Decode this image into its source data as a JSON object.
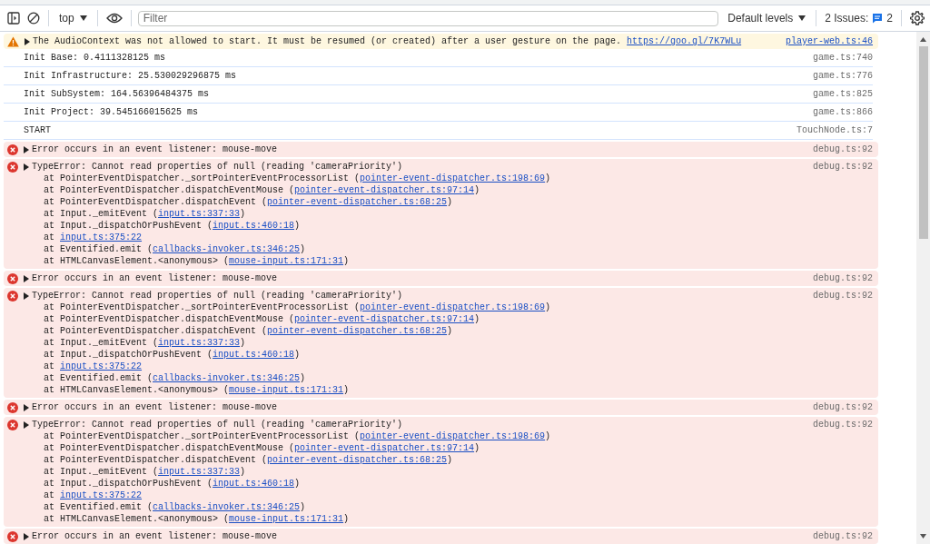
{
  "toolbar": {
    "context": "top",
    "filter": {
      "placeholder": "Filter"
    },
    "levels": "Default levels",
    "issues_label": "2 Issues:",
    "issues_count": "2"
  },
  "messages": [
    {
      "kind": "warning",
      "text": "The AudioContext was not allowed to start. It must be resumed (or created) after a user gesture on the page.",
      "link": "https://goo.gl/7K7WLu",
      "source": "player-web.ts:46",
      "expandable": true
    },
    {
      "kind": "log",
      "text": "Init Base: 0.4111328125 ms",
      "source": "game.ts:740",
      "expandable": false
    },
    {
      "kind": "log",
      "text": "Init Infrastructure: 25.530029296875 ms",
      "source": "game.ts:776",
      "expandable": false
    },
    {
      "kind": "log",
      "text": "Init SubSystem: 164.56396484375 ms",
      "source": "game.ts:825",
      "expandable": false
    },
    {
      "kind": "log",
      "text": "Init Project: 39.545166015625 ms",
      "source": "game.ts:866",
      "expandable": false
    },
    {
      "kind": "log",
      "text": "START",
      "source": "TouchNode.ts:7",
      "expandable": false
    },
    {
      "kind": "error",
      "text": "Error occurs in an event listener: mouse-move",
      "source": "debug.ts:92",
      "expandable": true
    },
    {
      "kind": "error",
      "text": "TypeError: Cannot read properties of null (reading 'cameraPriority')",
      "source": "debug.ts:92",
      "expandable": true,
      "stack": [
        {
          "before": "at PointerEventDispatcher._sortPointerEventProcessorList (",
          "link": "pointer-event-dispatcher.ts:198:69",
          "after": ")"
        },
        {
          "before": "at PointerEventDispatcher.dispatchEventMouse (",
          "link": "pointer-event-dispatcher.ts:97:14",
          "after": ")"
        },
        {
          "before": "at PointerEventDispatcher.dispatchEvent (",
          "link": "pointer-event-dispatcher.ts:68:25",
          "after": ")"
        },
        {
          "before": "at Input._emitEvent (",
          "link": "input.ts:337:33",
          "after": ")"
        },
        {
          "before": "at Input._dispatchOrPushEvent (",
          "link": "input.ts:460:18",
          "after": ")"
        },
        {
          "before": "at ",
          "link": "input.ts:375:22"
        },
        {
          "before": "at Eventified.emit (",
          "link": "callbacks-invoker.ts:346:25",
          "after": ")"
        },
        {
          "before": "at HTMLCanvasElement.<anonymous> (",
          "link": "mouse-input.ts:171:31",
          "after": ")"
        }
      ]
    },
    {
      "kind": "error",
      "text": "Error occurs in an event listener: mouse-move",
      "source": "debug.ts:92",
      "expandable": true
    },
    {
      "kind": "error",
      "text": "TypeError: Cannot read properties of null (reading 'cameraPriority')",
      "source": "debug.ts:92",
      "expandable": true,
      "stack": [
        {
          "before": "at PointerEventDispatcher._sortPointerEventProcessorList (",
          "link": "pointer-event-dispatcher.ts:198:69",
          "after": ")"
        },
        {
          "before": "at PointerEventDispatcher.dispatchEventMouse (",
          "link": "pointer-event-dispatcher.ts:97:14",
          "after": ")"
        },
        {
          "before": "at PointerEventDispatcher.dispatchEvent (",
          "link": "pointer-event-dispatcher.ts:68:25",
          "after": ")"
        },
        {
          "before": "at Input._emitEvent (",
          "link": "input.ts:337:33",
          "after": ")"
        },
        {
          "before": "at Input._dispatchOrPushEvent (",
          "link": "input.ts:460:18",
          "after": ")"
        },
        {
          "before": "at ",
          "link": "input.ts:375:22"
        },
        {
          "before": "at Eventified.emit (",
          "link": "callbacks-invoker.ts:346:25",
          "after": ")"
        },
        {
          "before": "at HTMLCanvasElement.<anonymous> (",
          "link": "mouse-input.ts:171:31",
          "after": ")"
        }
      ]
    },
    {
      "kind": "error",
      "text": "Error occurs in an event listener: mouse-move",
      "source": "debug.ts:92",
      "expandable": true
    },
    {
      "kind": "error",
      "text": "TypeError: Cannot read properties of null (reading 'cameraPriority')",
      "source": "debug.ts:92",
      "expandable": true,
      "stack": [
        {
          "before": "at PointerEventDispatcher._sortPointerEventProcessorList (",
          "link": "pointer-event-dispatcher.ts:198:69",
          "after": ")"
        },
        {
          "before": "at PointerEventDispatcher.dispatchEventMouse (",
          "link": "pointer-event-dispatcher.ts:97:14",
          "after": ")"
        },
        {
          "before": "at PointerEventDispatcher.dispatchEvent (",
          "link": "pointer-event-dispatcher.ts:68:25",
          "after": ")"
        },
        {
          "before": "at Input._emitEvent (",
          "link": "input.ts:337:33",
          "after": ")"
        },
        {
          "before": "at Input._dispatchOrPushEvent (",
          "link": "input.ts:460:18",
          "after": ")"
        },
        {
          "before": "at ",
          "link": "input.ts:375:22"
        },
        {
          "before": "at Eventified.emit (",
          "link": "callbacks-invoker.ts:346:25",
          "after": ")"
        },
        {
          "before": "at HTMLCanvasElement.<anonymous> (",
          "link": "mouse-input.ts:171:31",
          "after": ")"
        }
      ]
    },
    {
      "kind": "error",
      "text": "Error occurs in an event listener: mouse-move",
      "source": "debug.ts:92",
      "expandable": true
    }
  ]
}
